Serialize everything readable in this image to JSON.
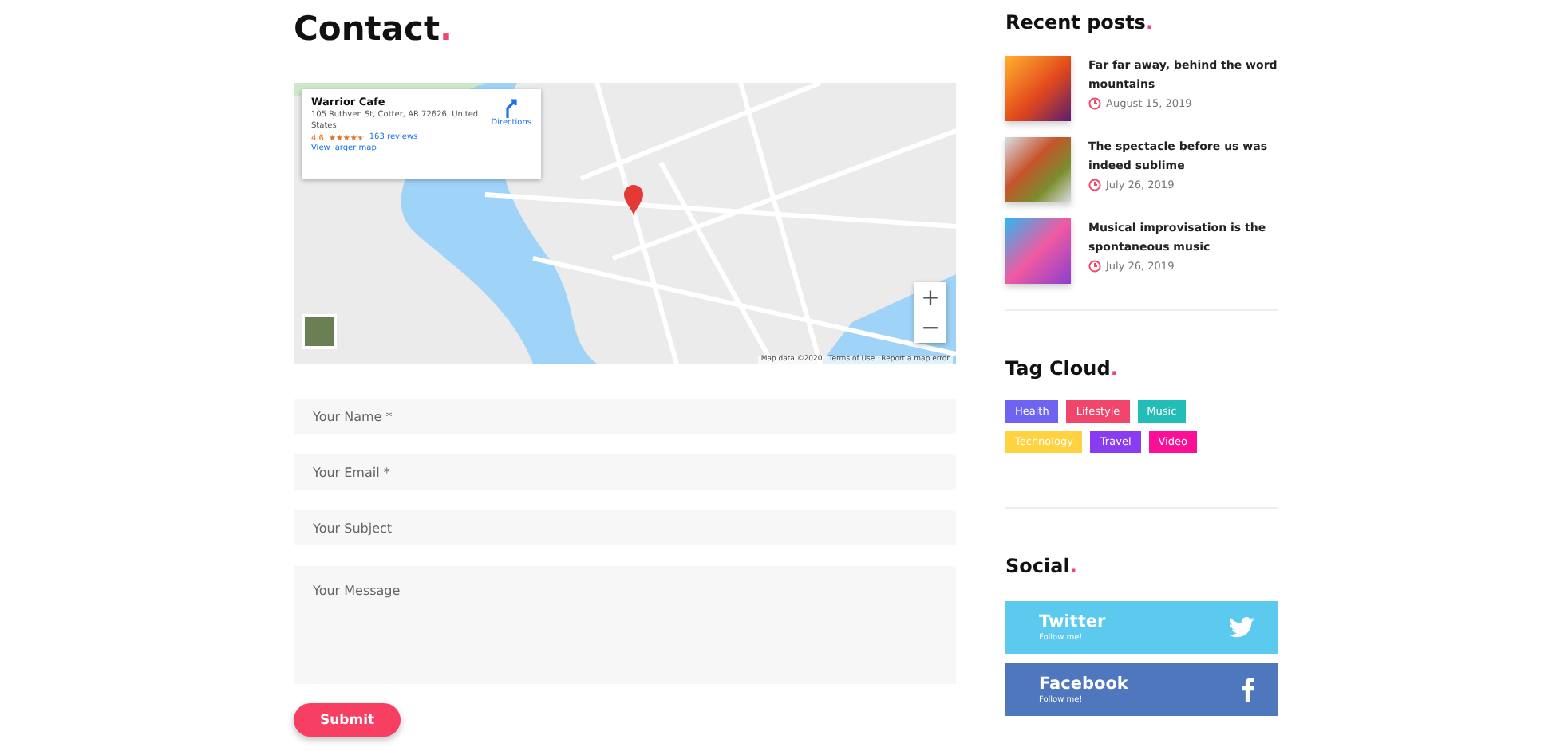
{
  "contact": {
    "title": "Contact",
    "title_mark": ".",
    "map": {
      "place": "Warrior Cafe",
      "address": "105 Ruthven St, Cotter, AR 72626, United States",
      "rating": "4.6",
      "stars": 4.5,
      "reviews": "163 reviews",
      "directions": "Directions",
      "larger_map": "View larger map",
      "zoom_in": "+",
      "zoom_out": "−",
      "attribution": [
        "Map data ©2020",
        "Terms of Use",
        "Report a map error"
      ]
    },
    "fields": [
      {
        "kind": "input",
        "placeholder": "Your Name *"
      },
      {
        "kind": "input",
        "placeholder": "Your Email *"
      },
      {
        "kind": "input",
        "placeholder": "Your Subject"
      },
      {
        "kind": "textarea",
        "placeholder": "Your Message"
      }
    ],
    "submit": "Submit"
  },
  "sidebar": {
    "recent_posts": {
      "title": "Recent posts",
      "title_mark": ".",
      "posts": [
        {
          "title": "Far far away, behind the word mountains",
          "date": "August 15, 2019"
        },
        {
          "title": "The spectacle before us was indeed sublime",
          "date": "July 26, 2019"
        },
        {
          "title": "Musical improvisation is the spontaneous music",
          "date": "July 26, 2019"
        }
      ]
    },
    "tag_cloud": {
      "title": "Tag Cloud",
      "title_mark": ".",
      "tags": [
        {
          "label": "Health",
          "color": "#6f63f2"
        },
        {
          "label": "Lifestyle",
          "color": "#f2456b"
        },
        {
          "label": "Music",
          "color": "#22bdb6"
        },
        {
          "label": "Technology",
          "color": "#ffd23f"
        },
        {
          "label": "Travel",
          "color": "#8a3df0"
        },
        {
          "label": "Video",
          "color": "#fa0f96"
        }
      ]
    },
    "social": {
      "title": "Social",
      "title_mark": ".",
      "links": [
        {
          "kind": "twitter",
          "name": "Twitter",
          "caption": "Follow me!"
        },
        {
          "kind": "facebook",
          "name": "Facebook",
          "caption": "Follow me!"
        }
      ]
    }
  }
}
